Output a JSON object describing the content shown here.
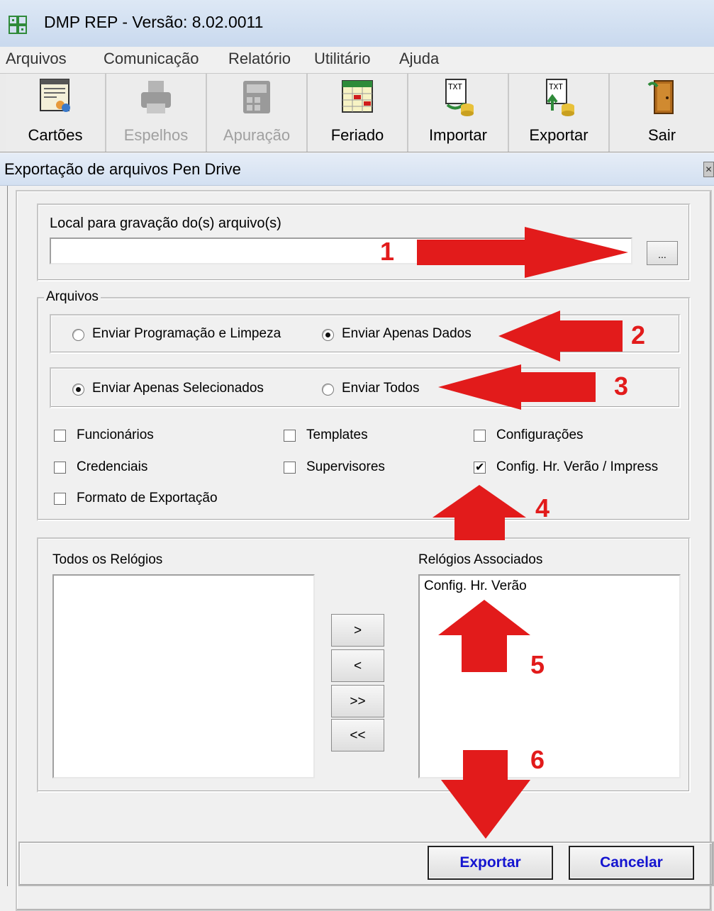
{
  "window": {
    "title": "DMP REP - Versão: 8.02.0011"
  },
  "menu": [
    "Arquivos",
    "Comunicação",
    "Relatório",
    "Utilitário",
    "Ajuda"
  ],
  "toolbar": [
    {
      "label": "Cartões",
      "icon": "cards-icon",
      "enabled": true
    },
    {
      "label": "Espelhos",
      "icon": "printer-icon",
      "enabled": false
    },
    {
      "label": "Apuração",
      "icon": "calculator-icon",
      "enabled": false
    },
    {
      "label": "Feriado",
      "icon": "calendar-icon",
      "enabled": true
    },
    {
      "label": "Importar",
      "icon": "txt-import-icon",
      "enabled": true
    },
    {
      "label": "Exportar",
      "icon": "txt-export-icon",
      "enabled": true
    },
    {
      "label": "Sair",
      "icon": "exit-door-icon",
      "enabled": true
    }
  ],
  "dialog": {
    "title": "Exportação de arquivos Pen Drive",
    "path": {
      "label": "Local para gravação do(s) arquivo(s)",
      "value": "",
      "browse_label": "..."
    },
    "arquivos": {
      "legend": "Arquivos",
      "mode": {
        "options": [
          "Enviar Programação e Limpeza",
          "Enviar Apenas Dados"
        ],
        "selected": "Enviar Apenas Dados"
      },
      "scope": {
        "options": [
          "Enviar Apenas Selecionados",
          "Enviar Todos"
        ],
        "selected": "Enviar Apenas Selecionados"
      },
      "checkboxes": [
        {
          "label": "Funcionários",
          "checked": false
        },
        {
          "label": "Templates",
          "checked": false
        },
        {
          "label": "Configurações",
          "checked": false
        },
        {
          "label": "Credenciais",
          "checked": false
        },
        {
          "label": "Supervisores",
          "checked": false
        },
        {
          "label": "Config. Hr. Verão / Impress",
          "checked": true
        },
        {
          "label": "Formato de Exportação",
          "checked": false
        }
      ]
    },
    "relogios": {
      "all_label": "Todos os Relógios",
      "all_items": [],
      "assoc_label": "Relógios Associados",
      "assoc_items": [
        "Config. Hr. Verão"
      ],
      "move_buttons": [
        ">",
        "<",
        ">>",
        "<<"
      ]
    },
    "footer": {
      "export_label": "Exportar",
      "cancel_label": "Cancelar"
    }
  },
  "annotations": {
    "color": "#e21b1b",
    "steps": [
      "1",
      "2",
      "3",
      "4",
      "5",
      "6"
    ]
  }
}
